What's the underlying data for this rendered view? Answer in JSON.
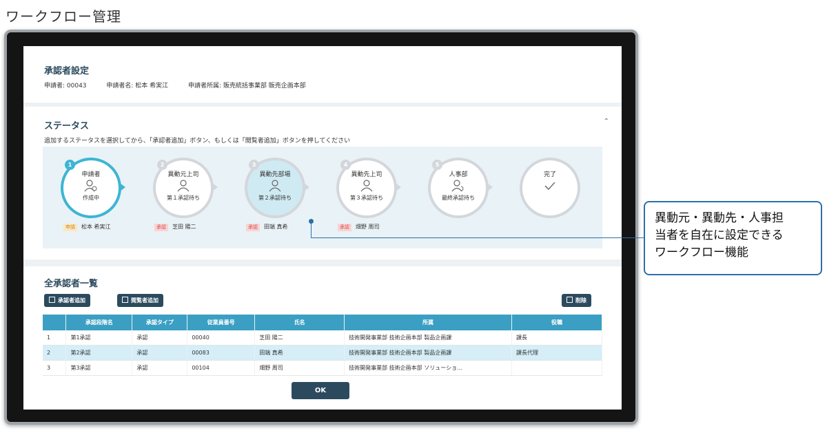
{
  "page_title": "ワークフロー管理",
  "approver_settings": {
    "title": "承認者設定",
    "applicant_id": "申請者: 00043",
    "applicant_name": "申請者名: 松本 希実江",
    "applicant_affiliation": "申請者所属: 販売統括事業部 販売企画本部"
  },
  "status": {
    "title": "ステータス",
    "collapse_icon": "chevron-up-icon",
    "instruction": "追加するステータスを選択してから、「承認者追加」ボタン、もしくは「閲覧者追加」ボタンを押してください",
    "steps": [
      {
        "num": "1",
        "name": "申請者",
        "status": "作成中",
        "icon": "user-edit-icon"
      },
      {
        "num": "2",
        "name": "異動元上司",
        "status": "第１承認待ち",
        "icon": "user-icon"
      },
      {
        "num": "3",
        "name": "異動先部場",
        "status": "第２承認待ち",
        "icon": "user-icon"
      },
      {
        "num": "4",
        "name": "異動先上司",
        "status": "第３承認待ち",
        "icon": "user-icon"
      },
      {
        "num": "5",
        "name": "人事部",
        "status": "最終承認待ち",
        "icon": "user-refresh-icon"
      },
      {
        "num": "",
        "name": "完了",
        "status": "",
        "icon": "check-icon"
      }
    ],
    "assignees": [
      {
        "tag": "申請",
        "name": "松本 希実江"
      },
      {
        "tag": "承認",
        "name": "芝田 陽二"
      },
      {
        "tag": "承認",
        "name": "田端 真希"
      },
      {
        "tag": "承認",
        "name": "畑野 周司"
      }
    ]
  },
  "approver_list": {
    "title": "全承認者一覧",
    "add_approver_label": "承認者追加",
    "add_viewer_label": "閲覧者追加",
    "delete_label": "削除",
    "columns": [
      "",
      "承認段階名",
      "承認タイプ",
      "従業員番号",
      "氏名",
      "所属",
      "役職"
    ],
    "rows": [
      [
        "1",
        "第1承認",
        "承認",
        "00040",
        "芝田 陽二",
        "技術開発事業部 技術企画本部 製品企画課",
        "課長"
      ],
      [
        "2",
        "第2承認",
        "承認",
        "00083",
        "田端 真希",
        "技術開発事業部 技術企画本部 製品企画課",
        "課長代理"
      ],
      [
        "3",
        "第3承認",
        "承認",
        "00104",
        "畑野 周司",
        "技術開発事業部 技術企画本部 ソリューショ…",
        ""
      ]
    ],
    "selected_row": 2,
    "ok_label": "OK"
  },
  "callout": {
    "line1": "異動元・異動先・人事担",
    "line2": "当者を自在に設定できる",
    "line3": "ワークフロー機能"
  },
  "colors": {
    "accent": "#3db5d4",
    "primary_button": "#2c4a5e",
    "table_header": "#3a9fc3",
    "selected_row": "#d5eef7",
    "callout_border": "#2c6fa8"
  }
}
